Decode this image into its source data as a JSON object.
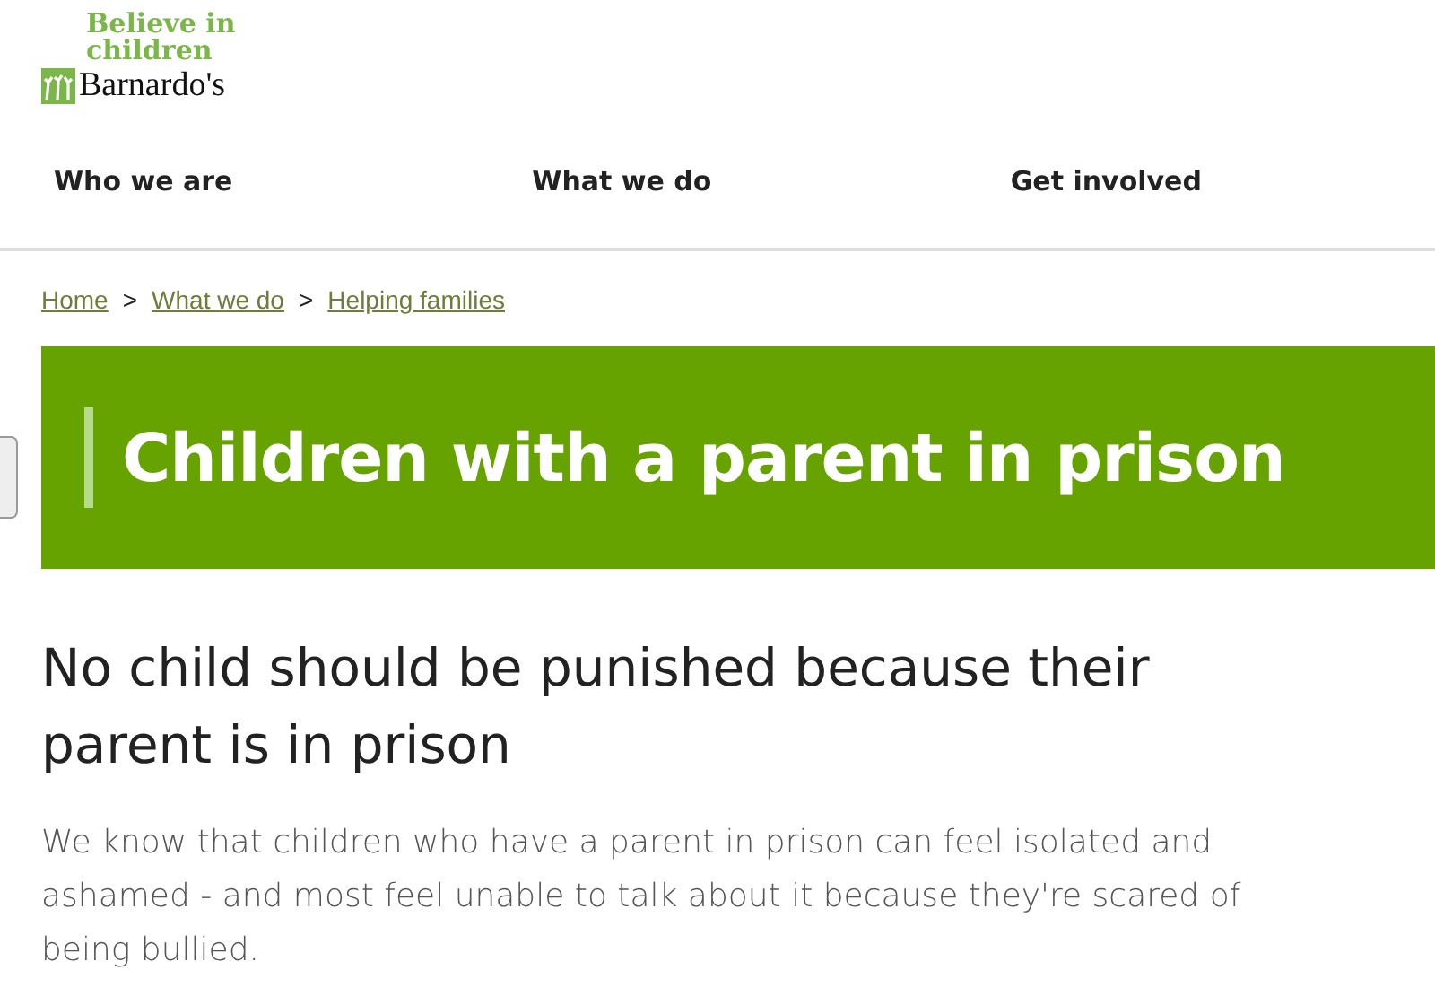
{
  "logo": {
    "tagline_line_1": "Believe in",
    "tagline_line_2": "children",
    "name": "Barnardo's"
  },
  "nav": [
    {
      "label": "Who we are"
    },
    {
      "label": "What we do"
    },
    {
      "label": "Get involved"
    }
  ],
  "breadcrumbs": {
    "separator": ">",
    "items": [
      {
        "label": "Home"
      },
      {
        "label": "What we do"
      },
      {
        "label": "Helping families"
      }
    ]
  },
  "banner": {
    "title": "Children with a parent in prison"
  },
  "heading": "No child should be punished because their parent is in prison",
  "paragraph": "We know that children who have a parent in prison can feel isolated and ashamed - and most feel unable to talk about it because they're scared of being bullied."
}
